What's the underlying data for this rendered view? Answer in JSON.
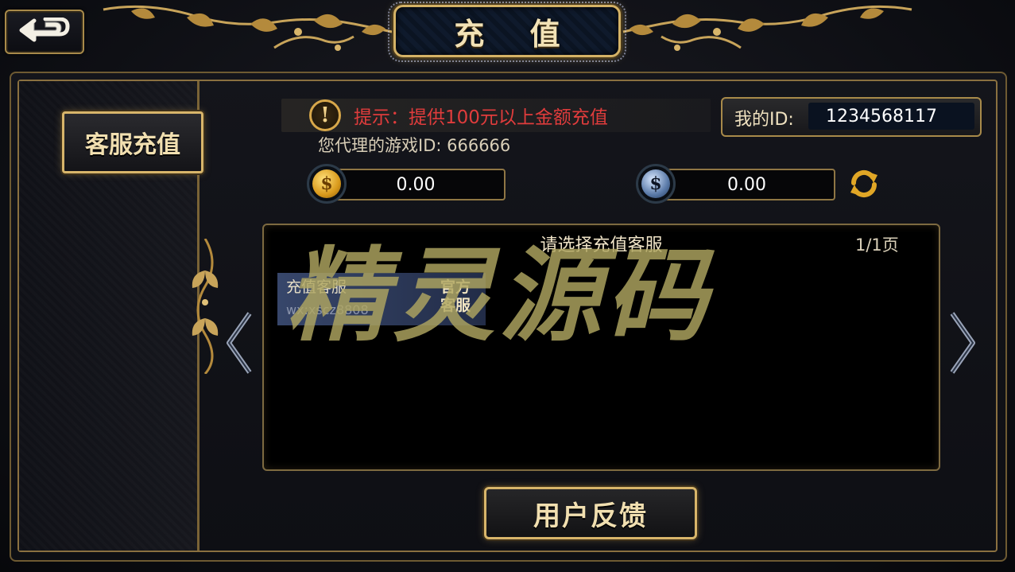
{
  "header": {
    "title": "充 值"
  },
  "sidebar": {
    "items": [
      {
        "label": "客服充值"
      }
    ]
  },
  "info": {
    "hint_text": "提示：提供100元以上金额充值",
    "agent_text": "您代理的游戏ID: 666666",
    "my_id_label": "我的ID:",
    "my_id_value": "1234568117"
  },
  "balances": {
    "gold": "0.00",
    "silver": "0.00"
  },
  "list": {
    "title": "请选择充值客服",
    "page": "1/1页",
    "items": [
      {
        "title": "充值客服",
        "subtitle": "wx:xscz8808",
        "badge": "官方客服"
      }
    ]
  },
  "footer": {
    "feedback_label": "用户反馈"
  },
  "watermark": "精灵源码",
  "icons": {
    "back": "back-arrow-icon",
    "hint": "exclamation-icon",
    "gold": "gold-coin-icon",
    "silver": "dollar-coin-icon",
    "refresh": "refresh-icon",
    "prev": "chevron-left-icon",
    "next": "chevron-right-icon"
  },
  "colors": {
    "gold_border": "#d8b56a",
    "hint_red": "#e03c3c",
    "selected_item": "#3a4a70"
  }
}
